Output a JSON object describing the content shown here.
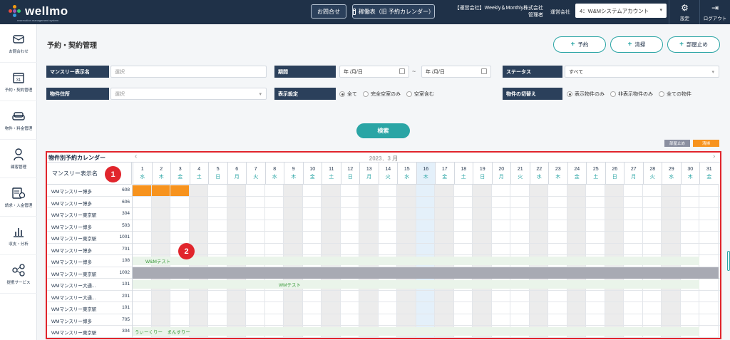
{
  "brand": {
    "name": "wellmo",
    "tagline": "reservation management system",
    "dot_colors": [
      "#e74c3c",
      "#f39c12",
      "#2ecc71",
      "#3498db",
      "#9b59b6",
      "#1abc9c"
    ]
  },
  "topbar": {
    "contact_label": "お問合せ",
    "calendar_label": "稼働表（旧 予約カレンダー）",
    "company_line1": "【運営会社】Weekly＆Monthly株式会社",
    "company_line2": "管理者",
    "org_label": "運営会社",
    "org_value": "4：W&Mシステムアカウント",
    "settings_label": "設定",
    "logout_label": "ログアウト",
    "bg_color": "#1f3148"
  },
  "sidebar": {
    "items": [
      {
        "label": "お問合わせ",
        "icon": "mail-icon"
      },
      {
        "label": "予約・契約管理",
        "icon": "calendar-icon"
      },
      {
        "label": "物件・料金管理",
        "icon": "sofa-icon"
      },
      {
        "label": "顧客管理",
        "icon": "person-icon"
      },
      {
        "label": "請求・入金管理",
        "icon": "invoice-icon"
      },
      {
        "label": "収支・分析",
        "icon": "bar-chart-icon"
      },
      {
        "label": "提携サービス",
        "icon": "network-icon"
      }
    ]
  },
  "page": {
    "title": "予約・契約管理",
    "actions": [
      "予約",
      "清掃",
      "部屋止め"
    ]
  },
  "filters": {
    "monthly_name_label": "マンスリー表示名",
    "monthly_name_placeholder": "選択",
    "period_label": "期間",
    "period_from": "年 /月/日",
    "period_to": "年 /月/日",
    "status_label": "ステータス",
    "status_value": "すべて",
    "address_label": "物件住所",
    "address_placeholder": "選択",
    "display_label": "表示設定",
    "display_options": [
      "全て",
      "完全空室のみ",
      "空室含む"
    ],
    "toggle_label": "物件の切替え",
    "toggle_options": [
      "表示物件のみ",
      "非表示物件のみ",
      "全ての物件"
    ],
    "search_label": "検索"
  },
  "legend": [
    {
      "label": "部屋止め",
      "color": "#8a8fa0"
    },
    {
      "label": "清掃",
      "color": "#f7931e"
    }
  ],
  "calendar": {
    "title": "物件別予約カレンダー",
    "month": "2023．3 月",
    "name_header": "マンスリー表示名",
    "prev": "‹",
    "next": "›",
    "markers": [
      "1",
      "2"
    ],
    "days": [
      {
        "d": "1",
        "w": "水"
      },
      {
        "d": "2",
        "w": "木"
      },
      {
        "d": "3",
        "w": "金"
      },
      {
        "d": "4",
        "w": "土"
      },
      {
        "d": "5",
        "w": "日"
      },
      {
        "d": "6",
        "w": "月"
      },
      {
        "d": "7",
        "w": "火"
      },
      {
        "d": "8",
        "w": "水"
      },
      {
        "d": "9",
        "w": "木"
      },
      {
        "d": "10",
        "w": "金"
      },
      {
        "d": "11",
        "w": "土"
      },
      {
        "d": "12",
        "w": "日"
      },
      {
        "d": "13",
        "w": "月"
      },
      {
        "d": "14",
        "w": "火"
      },
      {
        "d": "15",
        "w": "水"
      },
      {
        "d": "16",
        "w": "木"
      },
      {
        "d": "17",
        "w": "金"
      },
      {
        "d": "18",
        "w": "土"
      },
      {
        "d": "19",
        "w": "日"
      },
      {
        "d": "20",
        "w": "月"
      },
      {
        "d": "21",
        "w": "火"
      },
      {
        "d": "22",
        "w": "水"
      },
      {
        "d": "23",
        "w": "木"
      },
      {
        "d": "24",
        "w": "金"
      },
      {
        "d": "25",
        "w": "土"
      },
      {
        "d": "26",
        "w": "日"
      },
      {
        "d": "27",
        "w": "月"
      },
      {
        "d": "28",
        "w": "火"
      },
      {
        "d": "29",
        "w": "水"
      },
      {
        "d": "30",
        "w": "木"
      },
      {
        "d": "31",
        "w": "金"
      }
    ],
    "rows": [
      {
        "name": "WMマンスリー博多",
        "room": "608"
      },
      {
        "name": "WMマンスリー博多",
        "room": "606"
      },
      {
        "name": "WMマンスリー東京駅",
        "room": "304"
      },
      {
        "name": "WMマンスリー博多",
        "room": "503"
      },
      {
        "name": "WMマンスリー東京駅",
        "room": "1001"
      },
      {
        "name": "WMマンスリー博多",
        "room": "701"
      },
      {
        "name": "WMマンスリー博多",
        "room": "108"
      },
      {
        "name": "WMマンスリー東京駅",
        "room": "1002"
      },
      {
        "name": "WMマンスリー大通...",
        "room": "101"
      },
      {
        "name": "WMマンスリー大通...",
        "room": "201"
      },
      {
        "name": "WMマンスリー東京駅",
        "room": "101"
      },
      {
        "name": "WMマンスリー博多",
        "room": "705"
      },
      {
        "name": "WMマンスリー東京駅",
        "room": "304"
      }
    ],
    "bars": [
      {
        "row": 0,
        "from": 1,
        "to": 3,
        "type": "cleaning",
        "text": ""
      },
      {
        "row": 6,
        "from": 1,
        "to": 30,
        "type": "reservation",
        "text": "W&Mテスト"
      },
      {
        "row": 7,
        "from": 1,
        "to": 31,
        "type": "room-stop",
        "text": ""
      },
      {
        "row": 8,
        "from": 1,
        "to": 30,
        "type": "reservation",
        "text": "WMテスト"
      },
      {
        "row": 12,
        "from": 1,
        "to": 30,
        "type": "reservation",
        "text": "うぃーくりー　まんすりー"
      }
    ],
    "today": 16,
    "shaded_days": [
      2,
      4,
      6,
      9,
      11,
      13,
      15,
      17,
      19,
      22,
      24,
      26,
      29
    ]
  }
}
